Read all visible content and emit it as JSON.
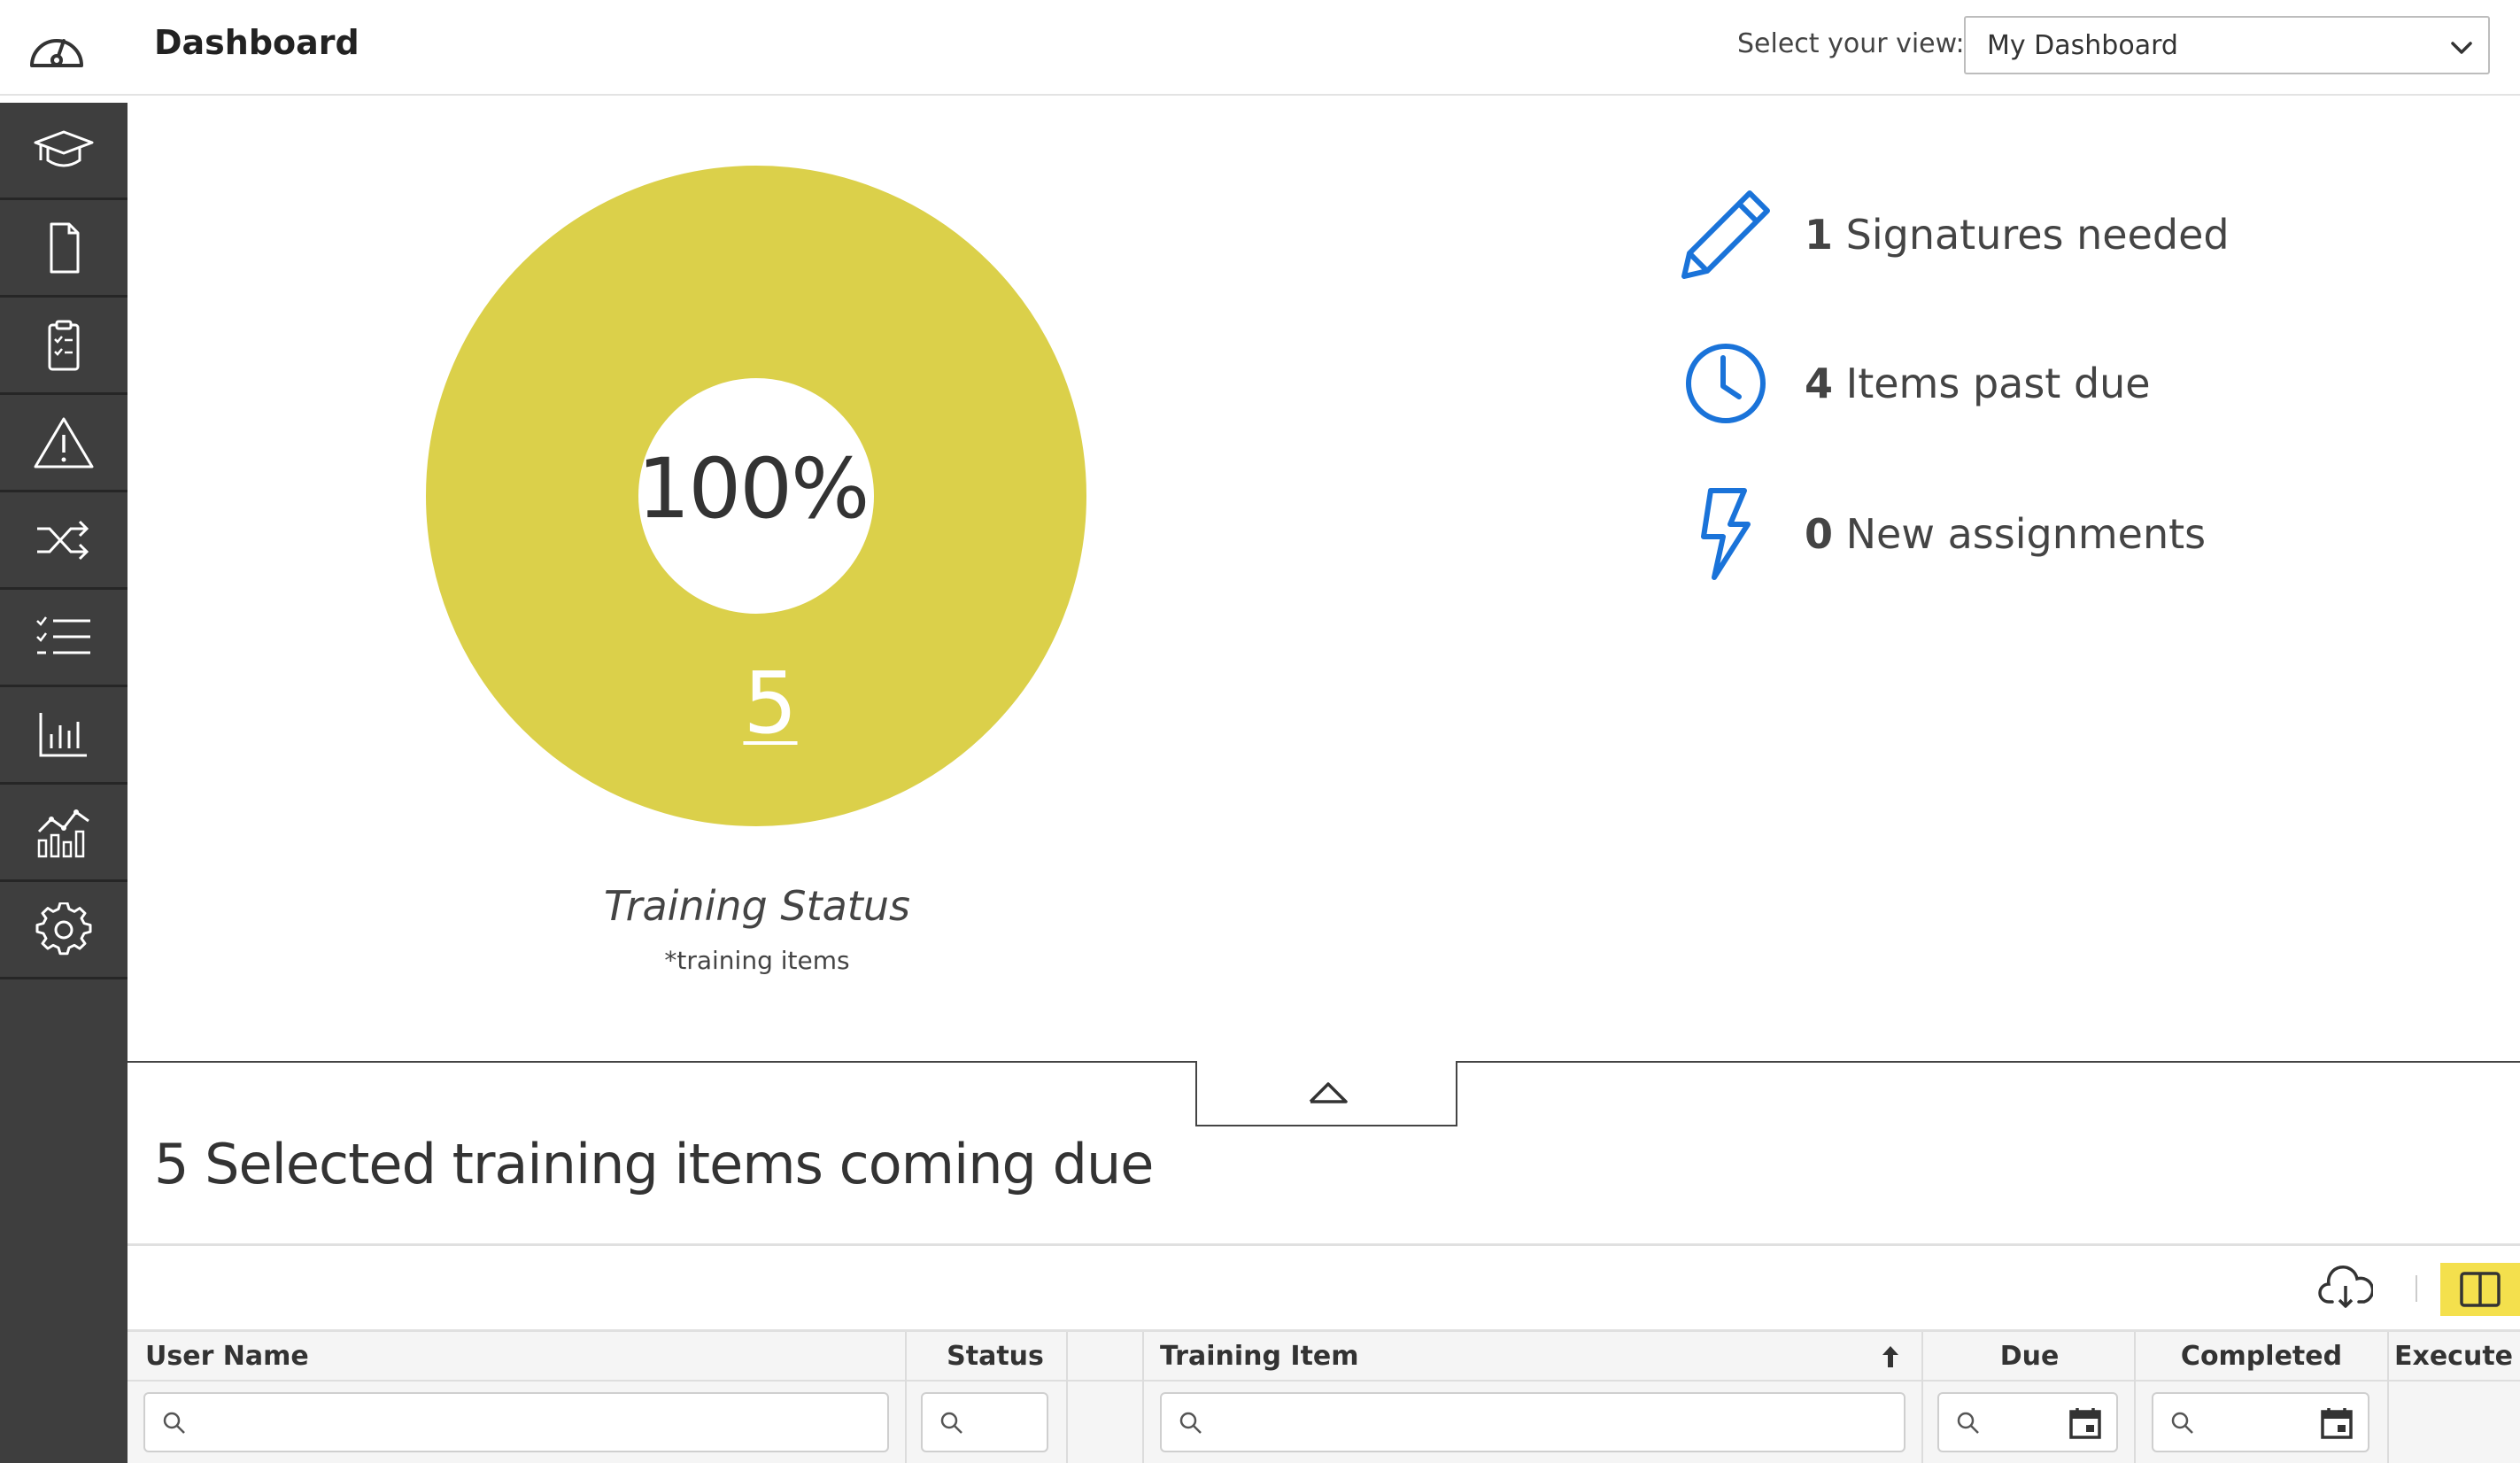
{
  "header": {
    "title": "Dashboard",
    "view_label": "Select your view:",
    "view_selected": "My Dashboard"
  },
  "sidebar": {
    "items": [
      {
        "icon": "graduation-cap-icon"
      },
      {
        "icon": "document-icon"
      },
      {
        "icon": "clipboard-checklist-icon"
      },
      {
        "icon": "warning-icon"
      },
      {
        "icon": "shuffle-icon"
      },
      {
        "icon": "checklist-icon"
      },
      {
        "icon": "bar-chart-icon"
      },
      {
        "icon": "analytics-chart-icon"
      },
      {
        "icon": "gear-icon"
      }
    ]
  },
  "training_status": {
    "percent": "100%",
    "count": "5",
    "title": "Training Status",
    "subtitle": "*training items",
    "color": "#dbd04a"
  },
  "stats": [
    {
      "number": "1",
      "label": "Signatures needed",
      "icon": "pencil-icon"
    },
    {
      "number": "4",
      "label": "Items past due",
      "icon": "clock-icon"
    },
    {
      "number": "0",
      "label": "New assignments",
      "icon": "lightning-icon"
    }
  ],
  "section": {
    "title": "5 Selected training items coming due"
  },
  "table": {
    "columns": [
      {
        "label": "User Name"
      },
      {
        "label": "Status"
      },
      {
        "label": ""
      },
      {
        "label": "Training Item"
      },
      {
        "label": "Due"
      },
      {
        "label": "Completed"
      },
      {
        "label": "Execute"
      }
    ]
  },
  "colors": {
    "sidebar_bg": "#3e3e3e",
    "accent_blue": "#1a73d9",
    "highlight_yellow": "#f4e04d"
  }
}
